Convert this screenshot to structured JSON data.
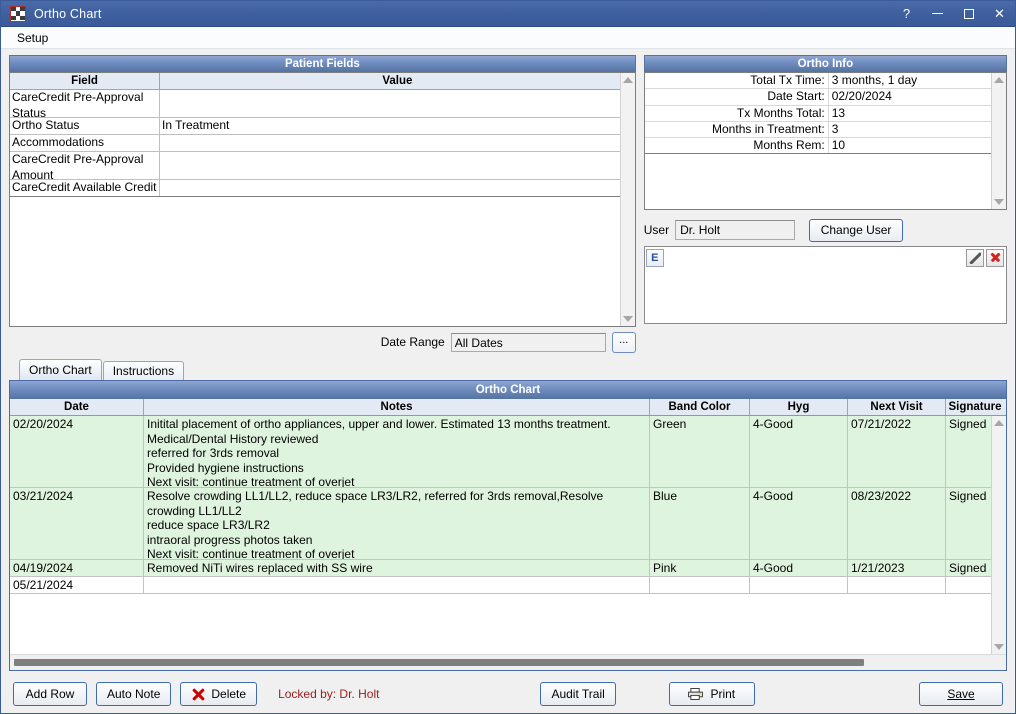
{
  "window": {
    "title": "Ortho Chart",
    "icon": "grid-icon",
    "controls": {
      "help": "?",
      "minimize": "minimize",
      "maximize": "maximize",
      "close": "close"
    }
  },
  "menubar": {
    "items": [
      {
        "label": "Setup"
      }
    ]
  },
  "patient_fields": {
    "title": "Patient Fields",
    "columns": [
      "Field",
      "Value"
    ],
    "rows": [
      {
        "field": "CareCredit Pre-Approval Status",
        "value": ""
      },
      {
        "field": "Ortho Status",
        "value": "In Treatment"
      },
      {
        "field": "Accommodations",
        "value": ""
      },
      {
        "field": "CareCredit Pre-Approval Amount",
        "value": ""
      },
      {
        "field": "CareCredit Available Credit",
        "value": ""
      }
    ]
  },
  "date_range": {
    "label": "Date Range",
    "value": "All Dates",
    "browse_label": "..."
  },
  "ortho_info": {
    "title": "Ortho Info",
    "rows": [
      {
        "key": "Total Tx Time:",
        "value": "3 months, 1 day"
      },
      {
        "key": "Date Start:",
        "value": "02/20/2024"
      },
      {
        "key": "Tx Months Total:",
        "value": "13"
      },
      {
        "key": "Months in Treatment:",
        "value": "3"
      },
      {
        "key": "Months Rem:",
        "value": "10"
      }
    ]
  },
  "user_section": {
    "label": "User",
    "value": "Dr. Holt",
    "change_user_label": "Change User",
    "editor_button_label": "E"
  },
  "tabs": [
    {
      "label": "Ortho Chart",
      "active": true
    },
    {
      "label": "Instructions",
      "active": false
    }
  ],
  "ortho_chart": {
    "title": "Ortho Chart",
    "columns": [
      "Date",
      "Notes",
      "Band Color",
      "Hyg",
      "Next Visit",
      "Signature"
    ],
    "rows": [
      {
        "date": "02/20/2024",
        "notes": "Initital placement of ortho appliances, upper and lower. Estimated 13 months treatment.\nMedical/Dental History reviewed\nreferred for 3rds removal\nProvided hygiene instructions\nNext visit: continue treatment of overjet",
        "band_color": "Green",
        "hyg": "4-Good",
        "next_visit": "07/21/2022",
        "signature": "Signed",
        "filled": true
      },
      {
        "date": "03/21/2024",
        "notes": "Resolve crowding LL1/LL2, reduce space LR3/LR2, referred for 3rds removal,Resolve crowding LL1/LL2\nreduce space LR3/LR2\nintraoral progress photos taken\nNext visit: continue treatment of overjet",
        "band_color": "Blue",
        "hyg": "4-Good",
        "next_visit": "08/23/2022",
        "signature": "Signed",
        "filled": true
      },
      {
        "date": "04/19/2024",
        "notes": "Removed NiTi wires replaced with SS wire",
        "band_color": "Pink",
        "hyg": "4-Good",
        "next_visit": "1/21/2023",
        "signature": "Signed",
        "filled": true
      },
      {
        "date": "05/21/2024",
        "notes": "",
        "band_color": "",
        "hyg": "",
        "next_visit": "",
        "signature": "",
        "filled": false
      }
    ]
  },
  "bottom_bar": {
    "add_row_label": "Add Row",
    "auto_note_label": "Auto Note",
    "delete_label": "Delete",
    "locked_text": "Locked by: Dr. Holt",
    "audit_trail_label": "Audit Trail",
    "print_label": "Print",
    "save_label": "Save"
  },
  "colors": {
    "accent": "#3f5f9e",
    "panel_header_start": "#8fa6cf",
    "panel_header_end": "#54739f",
    "row_filled": "#dff4de",
    "locked_text": "#9b1c1c"
  }
}
